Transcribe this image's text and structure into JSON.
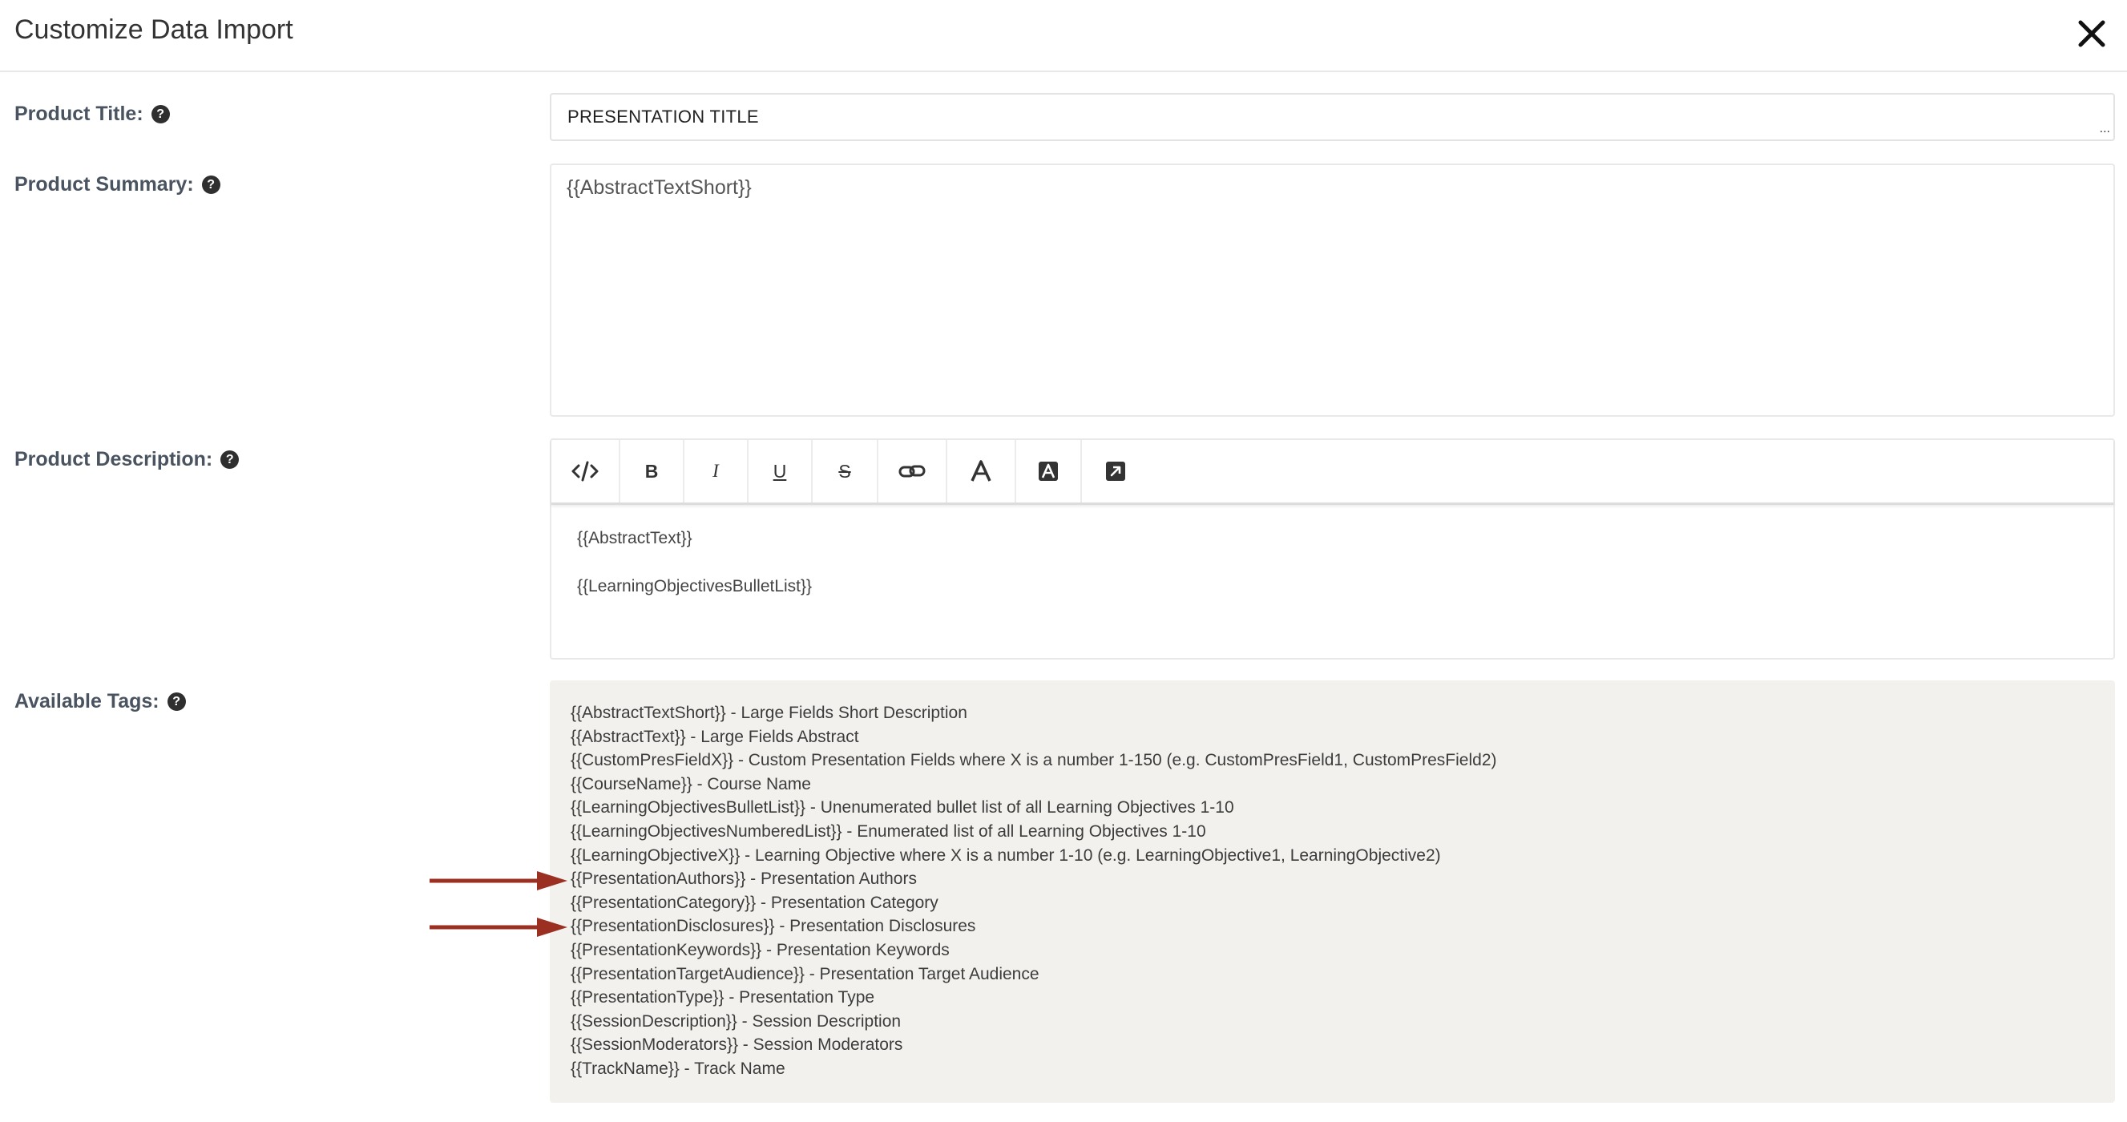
{
  "dialog": {
    "title": "Customize Data Import"
  },
  "product_title": {
    "label": "Product Title:",
    "value": "PRESENTATION TITLE"
  },
  "product_summary": {
    "label": "Product Summary:",
    "value": "{{AbstractTextShort}}"
  },
  "product_description": {
    "label": "Product Description:",
    "toolbar": [
      "code-view",
      "bold",
      "italic",
      "underline",
      "strikethrough",
      "link",
      "font-color",
      "background-color",
      "expand"
    ],
    "toolbar_labels": {
      "bold": "B",
      "italic": "I",
      "underline": "U",
      "strikethrough": "S"
    },
    "lines": [
      "{{AbstractText}}",
      "{{LearningObjectivesBulletList}}"
    ]
  },
  "available_tags": {
    "label": "Available Tags:",
    "items": [
      "{{AbstractTextShort}} - Large Fields Short Description",
      "{{AbstractText}} - Large Fields Abstract",
      "{{CustomPresFieldX}} - Custom Presentation Fields where X is a number 1-150 (e.g. CustomPresField1, CustomPresField2)",
      "{{CourseName}} - Course Name",
      "{{LearningObjectivesBulletList}} - Unenumerated bullet list of all Learning Objectives 1-10",
      "{{LearningObjectivesNumberedList}} - Enumerated list of all Learning Objectives 1-10",
      "{{LearningObjectiveX}} - Learning Objective where X is a number 1-10 (e.g. LearningObjective1, LearningObjective2)",
      "{{PresentationAuthors}} - Presentation Authors",
      "{{PresentationCategory}} - Presentation Category",
      "{{PresentationDisclosures}} - Presentation Disclosures",
      "{{PresentationKeywords}} - Presentation Keywords",
      "{{PresentationTargetAudience}} - Presentation Target Audience",
      "{{PresentationType}} - Presentation Type",
      "{{SessionDescription}} - Session Description",
      "{{SessionModerators}} - Session Moderators",
      "{{TrackName}} - Track Name"
    ]
  },
  "annotations": {
    "arrow_color": "#9b2f22"
  },
  "colors": {
    "label": "#4a5360",
    "tags_background": "#f2f1ed"
  }
}
